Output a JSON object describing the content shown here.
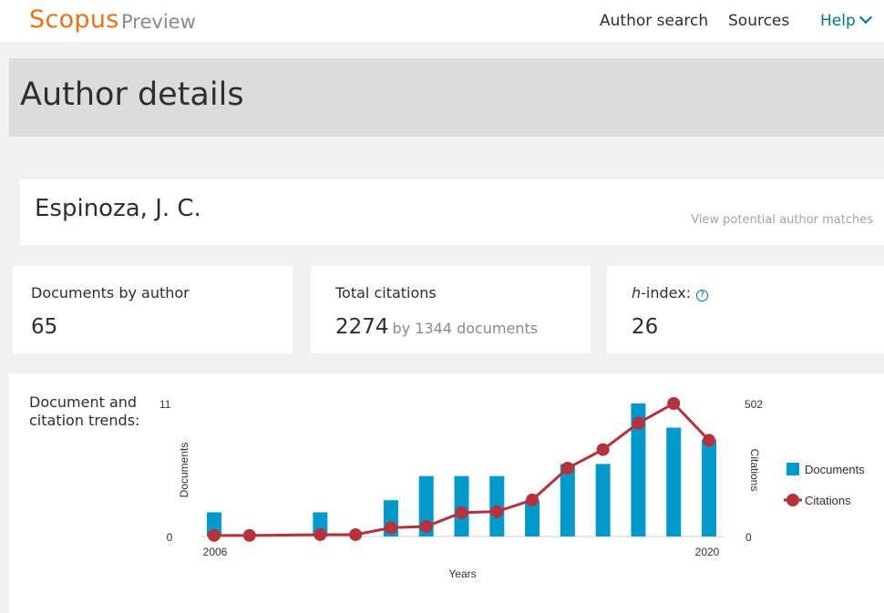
{
  "header": {
    "logo": "Scopus",
    "logo_sub": "Preview",
    "nav": {
      "author_search": "Author search",
      "sources": "Sources",
      "help": "Help"
    }
  },
  "page": {
    "title": "Author details"
  },
  "author": {
    "name": "Espinoza, J. C.",
    "matches_link": "View potential author matches"
  },
  "metrics": {
    "documents": {
      "label": "Documents by author",
      "value": "65"
    },
    "citations": {
      "label": "Total citations",
      "value": "2274",
      "suffix": "by 1344 documents"
    },
    "hindex": {
      "label_prefix": "h",
      "label_rest": "-index:",
      "value": "26"
    }
  },
  "chart_label": "Document and citation trends:",
  "colors": {
    "brand": "#e9711c",
    "link": "#007398",
    "documents": "#0099cc",
    "citations": "#b5323c"
  },
  "chart_data": {
    "type": "bar",
    "xlabel": "Years",
    "ylabel_left": "Documents",
    "ylabel_right": "Citations",
    "ylim_left": [
      0,
      11
    ],
    "ylim_right": [
      0,
      502
    ],
    "x_tick_labels": [
      "2006",
      "2020"
    ],
    "legend_position": "right",
    "series": [
      {
        "name": "Documents",
        "type": "bar",
        "axis": "left",
        "x": [
          2006,
          2009,
          2011,
          2012,
          2013,
          2014,
          2015,
          2016,
          2017,
          2018,
          2019,
          2020
        ],
        "values": [
          2,
          2,
          3,
          5,
          5,
          5,
          3,
          6,
          6,
          11,
          9,
          8
        ]
      },
      {
        "name": "Citations",
        "type": "line",
        "axis": "right",
        "x": [
          2006,
          2007,
          2009,
          2010,
          2011,
          2012,
          2013,
          2014,
          2015,
          2016,
          2017,
          2018,
          2019,
          2020
        ],
        "values": [
          4,
          4,
          7,
          7,
          33,
          38,
          90,
          94,
          138,
          258,
          328,
          428,
          502,
          363
        ]
      }
    ]
  }
}
